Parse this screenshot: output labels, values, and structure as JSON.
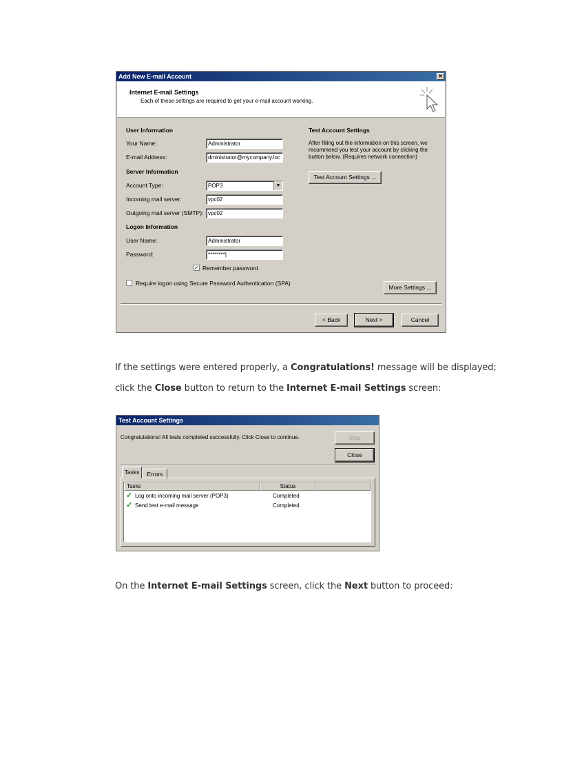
{
  "dialog1": {
    "title": "Add New E-mail Account",
    "header_title": "Internet E-mail Settings",
    "header_subtitle": "Each of these settings are required to get your e-mail account working.",
    "user_info_heading": "User Information",
    "your_name_label": "Your Name:",
    "your_name_value": "Administrator",
    "email_label": "E-mail Address:",
    "email_value": "dministrator@mycompany.loc",
    "server_info_heading": "Server Information",
    "account_type_label": "Account Type:",
    "account_type_value": "POP3",
    "incoming_label": "Incoming mail server:",
    "incoming_value": "vpc02",
    "outgoing_label": "Outgoing mail server (SMTP):",
    "outgoing_value": "vpc02",
    "logon_info_heading": "Logon Information",
    "username_label": "User Name:",
    "username_value": "Administrator",
    "password_label": "Password:",
    "password_value": "********|",
    "remember_label": "Remember password",
    "spa_label": "Require logon using Secure Password Authentication (SPA)",
    "test_heading": "Test Account Settings",
    "test_desc_1": "After filling out the information on this screen, we",
    "test_desc_2": "recommend you test your account by clicking the",
    "test_desc_3": "button below. (Requires network connection)",
    "test_button": "Test Account Settings ...",
    "more_button": "More Settings ...",
    "back_button": "< Back",
    "next_button": "Next >",
    "cancel_button": "Cancel"
  },
  "para1": {
    "t1": "If the settings were entered properly, a ",
    "b1": "Congratulations!",
    "t2": "  message will be displayed;"
  },
  "para2": {
    "t1": "click the ",
    "b1": "Close",
    "t2": " button to return to the ",
    "b2": "Internet E-mail  Settings",
    "t3": " screen:"
  },
  "dialog2": {
    "title": "Test Account Settings",
    "message": "Congratulations! All tests completed successfully. Click Close to continue.",
    "stop_button": "Stop",
    "close_button": "Close",
    "tabs": [
      "Tasks",
      "Errors"
    ],
    "columns": [
      "Tasks",
      "Status"
    ],
    "rows": [
      {
        "task": "Log onto incoming mail server (POP3)",
        "status": "Completed"
      },
      {
        "task": "Send test e-mail message",
        "status": "Completed"
      }
    ]
  },
  "para3": {
    "t1": "On the ",
    "b1": "Internet E-mail  Settings",
    "t2": " screen, click the ",
    "b2": "Next",
    "t3": " button to proceed:"
  },
  "colors": {
    "titlebar_start": "#0a246a",
    "titlebar_end": "#3a6ea5",
    "dialog_face": "#d4d0c8",
    "check_green": "#2a8a2a"
  }
}
